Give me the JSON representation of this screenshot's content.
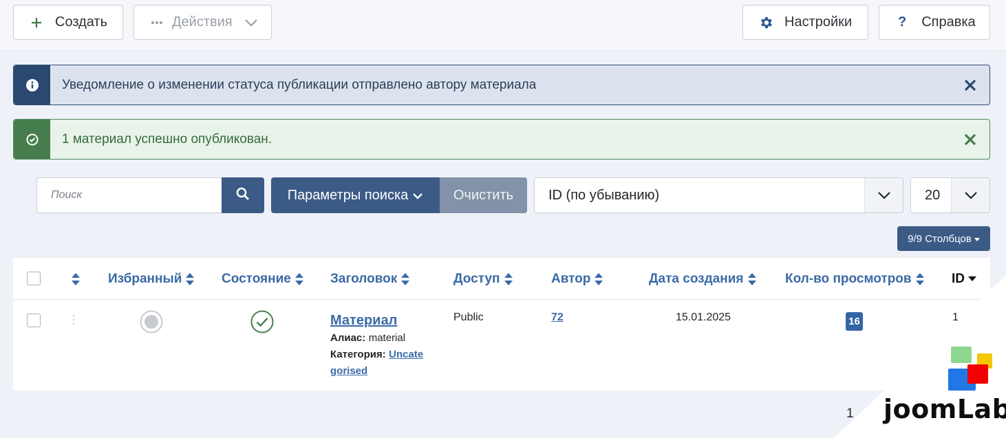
{
  "toolbar": {
    "create_label": "Создать",
    "actions_label": "Действия",
    "settings_label": "Настройки",
    "help_label": "Справка"
  },
  "alerts": {
    "info_text": "Уведомление о изменении статуса публикации отправлено автору материала",
    "success_text": "1 материал успешно опубликован."
  },
  "filters": {
    "search_placeholder": "Поиск",
    "search_options_label": "Параметры поиска",
    "clear_label": "Очистить",
    "ordering_value": "ID (по убыванию)",
    "limit_value": "20",
    "columns_label": "9/9 Столбцов"
  },
  "table": {
    "headers": {
      "featured": "Избранный",
      "status": "Состояние",
      "title": "Заголовок",
      "access": "Доступ",
      "author": "Автор",
      "created": "Дата создания",
      "hits": "Кол-во просмотров",
      "id": "ID"
    },
    "rows": [
      {
        "title": "Материал",
        "alias_label": "Алиас:",
        "alias": "material",
        "category_label": "Категория:",
        "category_line1": "Uncate",
        "category_line2": "gorised",
        "access": "Public",
        "author": "72",
        "created": "15.01.2025",
        "hits": "16",
        "id": "1"
      }
    ]
  },
  "pagination": {
    "current": "1"
  },
  "watermark": {
    "text": "joomLab"
  },
  "colors": {
    "primary": "#3b5b86",
    "info": "#2a4870",
    "success": "#457d4c",
    "link": "#3a6aa6"
  }
}
